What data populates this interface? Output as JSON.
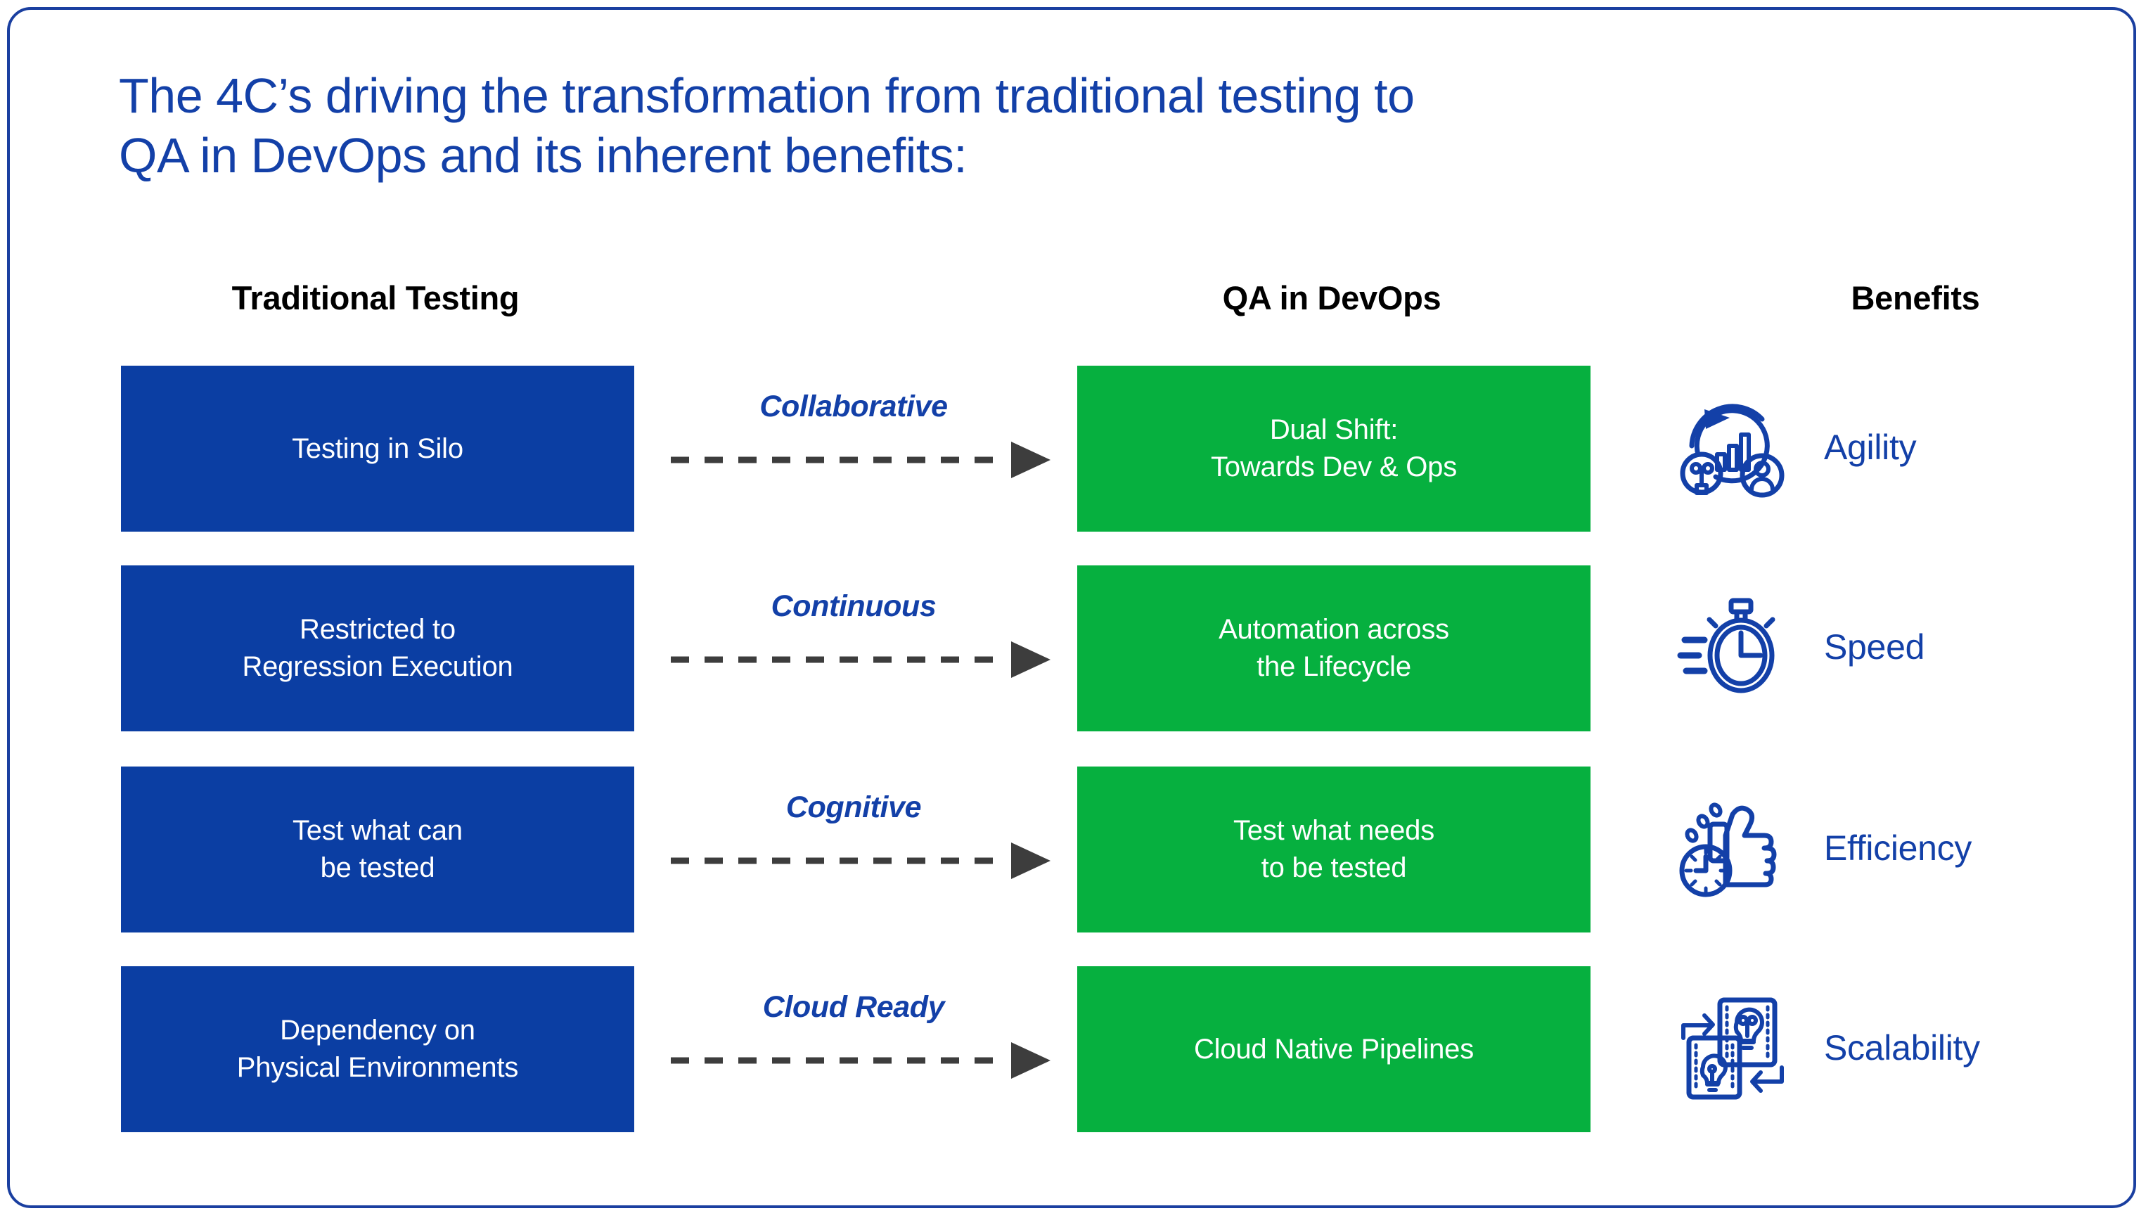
{
  "title": {
    "line1": "The 4C’s driving the transformation from traditional testing to",
    "line2": "QA in DevOps and its inherent benefits:"
  },
  "headers": {
    "traditional": "Traditional Testing",
    "qa_devops": "QA in DevOps",
    "benefits": "Benefits"
  },
  "colors": {
    "brand_blue": "#1340a8",
    "box_blue": "#0b3ea3",
    "box_green": "#06b03f",
    "arrow_gray": "#3d3d3d",
    "border_blue": "#1a3fa0",
    "header_black": "#000000"
  },
  "rows": [
    {
      "traditional": "Testing in Silo",
      "connector_label": "Collaborative",
      "qa_devops": "Dual Shift:\nTowards Dev & Ops",
      "benefit_label": "Agility",
      "benefit_icon": "agility-cycle-chart-icon"
    },
    {
      "traditional": "Restricted to\nRegression Execution",
      "connector_label": "Continuous",
      "qa_devops": "Automation across\nthe Lifecycle",
      "benefit_label": "Speed",
      "benefit_icon": "stopwatch-icon"
    },
    {
      "traditional": "Test  what can\nbe tested",
      "connector_label": "Cognitive",
      "qa_devops": "Test  what needs\nto be tested",
      "benefit_label": "Efficiency",
      "benefit_icon": "thumbs-up-clock-icon"
    },
    {
      "traditional": "Dependency on\nPhysical Environments",
      "connector_label": "Cloud Ready",
      "qa_devops": "Cloud Native Pipelines",
      "benefit_label": "Scalability",
      "benefit_icon": "scalable-cards-bulb-icon"
    }
  ]
}
